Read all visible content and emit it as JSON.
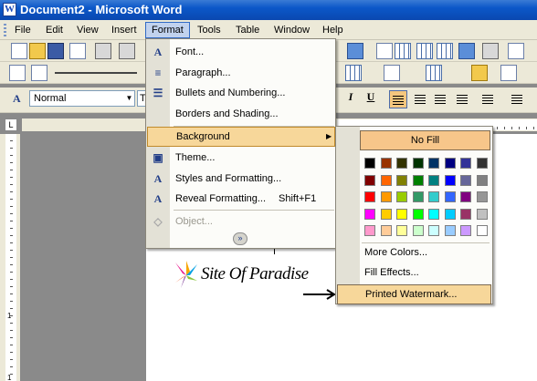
{
  "window": {
    "title": "Document2 - Microsoft Word",
    "app_icon": "word-icon"
  },
  "menubar": {
    "items": [
      "File",
      "Edit",
      "View",
      "Insert",
      "Format",
      "Tools",
      "Table",
      "Window",
      "Help"
    ],
    "active": "Format"
  },
  "toolbar": {
    "style_value": "Normal",
    "font_value": "T"
  },
  "format_menu": {
    "items": [
      {
        "label": "Font...",
        "icon": "font-A-icon"
      },
      {
        "label": "Paragraph...",
        "icon": "paragraph-icon"
      },
      {
        "label": "Bullets and Numbering...",
        "icon": "bullets-icon"
      },
      {
        "label": "Borders and Shading...",
        "icon": ""
      },
      {
        "label": "Background",
        "icon": "",
        "submenu": true
      },
      {
        "label": "Theme...",
        "icon": "theme-icon"
      },
      {
        "label": "Styles and Formatting...",
        "icon": "styles-icon"
      },
      {
        "label": "Reveal Formatting...",
        "shortcut": "Shift+F1",
        "icon": "reveal-icon"
      },
      {
        "label": "Object...",
        "icon": "object-icon",
        "disabled": true
      }
    ]
  },
  "background_menu": {
    "no_fill_label": "No Fill",
    "palette": [
      [
        "#000000",
        "#993300",
        "#333300",
        "#003300",
        "#003366",
        "#000080",
        "#333399",
        "#333333"
      ],
      [
        "#800000",
        "#FF6600",
        "#808000",
        "#008000",
        "#008080",
        "#0000FF",
        "#666699",
        "#808080"
      ],
      [
        "#FF0000",
        "#FF9900",
        "#99CC00",
        "#339966",
        "#33CCCC",
        "#3366FF",
        "#800080",
        "#969696"
      ],
      [
        "#FF00FF",
        "#FFCC00",
        "#FFFF00",
        "#00FF00",
        "#00FFFF",
        "#00CCFF",
        "#993366",
        "#C0C0C0"
      ],
      [
        "#FF99CC",
        "#FFCC99",
        "#FFFF99",
        "#CCFFCC",
        "#CCFFFF",
        "#99CCFF",
        "#CC99FF",
        "#FFFFFF"
      ]
    ],
    "items": [
      "More Colors...",
      "Fill Effects...",
      "Printed Watermark..."
    ]
  },
  "document": {
    "watermark_text": "Site Of Paradise"
  },
  "ruler": {
    "vertical_numbers": [
      "1",
      "1"
    ]
  },
  "colors": {
    "title_bar": "#0a48b0",
    "menu_highlight": "#f7d79a",
    "no_fill_bg": "#f7c68a"
  }
}
